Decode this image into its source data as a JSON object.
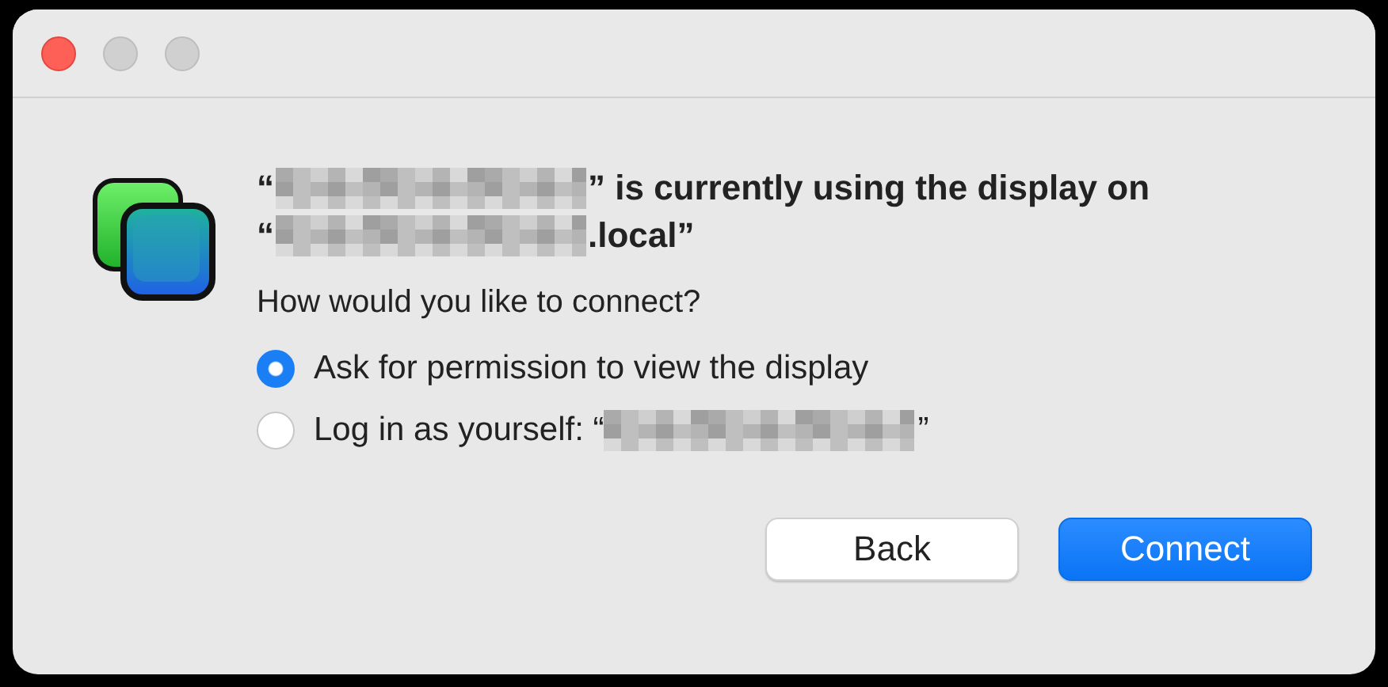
{
  "window": {
    "controls": [
      {
        "kind": "close",
        "disabled": false
      },
      {
        "kind": "minimize",
        "disabled": true
      },
      {
        "kind": "zoom",
        "disabled": true
      }
    ]
  },
  "message": {
    "lines": [
      [
        {
          "kind": "text",
          "text": "“"
        },
        {
          "kind": "redacted"
        },
        {
          "kind": "text",
          "text": "” is currently using the display on"
        }
      ],
      [
        {
          "kind": "text",
          "text": "“"
        },
        {
          "kind": "redacted"
        },
        {
          "kind": "text",
          "text": ".local”"
        }
      ]
    ],
    "question": "How would you like to connect?"
  },
  "options": [
    {
      "selected": true,
      "parts": [
        {
          "kind": "text",
          "text": "Ask for permission to view the display"
        }
      ]
    },
    {
      "selected": false,
      "parts": [
        {
          "kind": "text",
          "text": "Log in as yourself: “"
        },
        {
          "kind": "redacted"
        },
        {
          "kind": "text",
          "text": "”"
        }
      ]
    }
  ],
  "buttons": [
    {
      "label": "Back",
      "kind": "secondary"
    },
    {
      "label": "Connect",
      "kind": "primary"
    }
  ]
}
